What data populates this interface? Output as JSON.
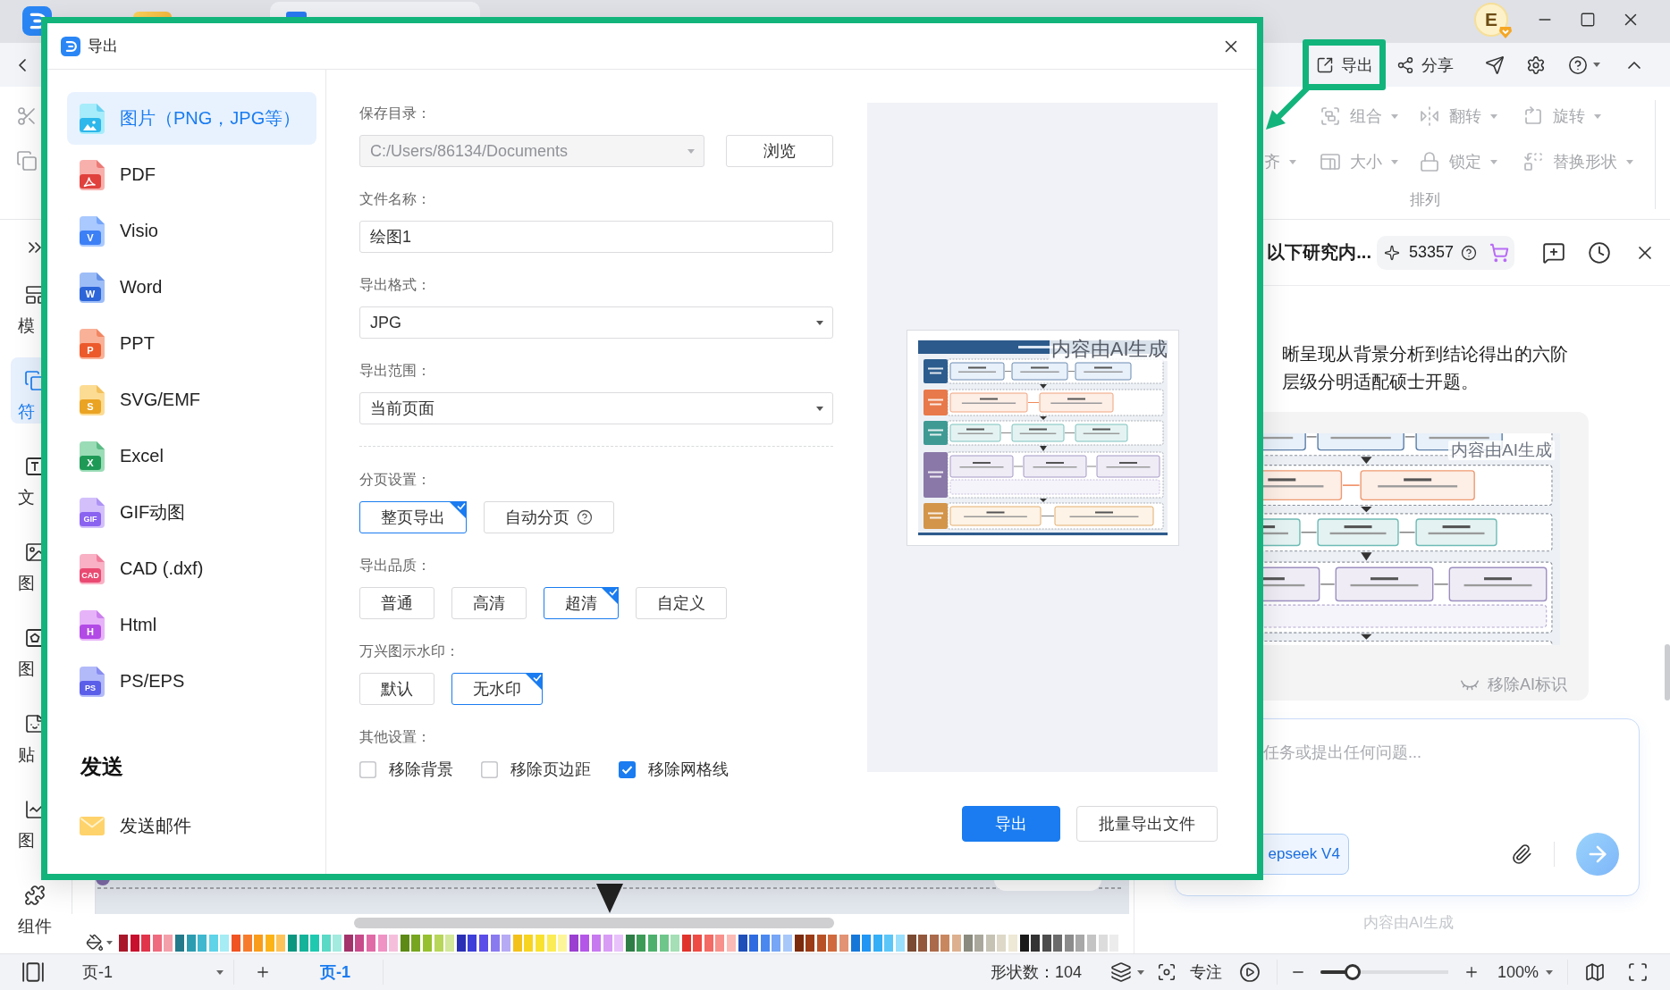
{
  "title_bar": {
    "avatar": "E"
  },
  "toolbar": {
    "actions": [
      {
        "kind": "export",
        "label": "导出",
        "highlighted": true
      },
      {
        "kind": "share",
        "label": "分享",
        "highlighted": false
      }
    ]
  },
  "ribbon": {
    "arrange": {
      "rows": [
        [
          "",
          {
            "kind": "group",
            "label": "组合",
            "disabled": true
          },
          {
            "kind": "flip",
            "label": "翻转",
            "disabled": true
          },
          {
            "kind": "rotate",
            "label": "旋转",
            "disabled": true
          }
        ],
        [
          {
            "kind": "text",
            "label": "齐",
            "disabled": true
          },
          {
            "kind": "size",
            "label": "大小",
            "disabled": true
          },
          {
            "kind": "lock",
            "label": "锁定",
            "disabled": true
          },
          {
            "kind": "replace",
            "label": "替换形状",
            "disabled": true
          }
        ]
      ],
      "label": "排列"
    }
  },
  "sidebar": {
    "items": [
      {
        "kind": "template",
        "label": "模",
        "selected": false
      },
      {
        "kind": "symbol",
        "label": "符",
        "selected": true
      },
      {
        "kind": "text",
        "label": "文",
        "selected": false
      },
      {
        "kind": "image",
        "label": "图",
        "selected": false
      },
      {
        "kind": "icon",
        "label": "图",
        "selected": false
      },
      {
        "kind": "sticker",
        "label": "贴",
        "selected": false
      },
      {
        "kind": "chart",
        "label": "图",
        "selected": false
      },
      {
        "kind": "component",
        "label": "组件",
        "selected": false
      }
    ]
  },
  "palette": [
    {
      "color": "#a8182a"
    },
    {
      "color": "#c8102e"
    },
    {
      "color": "#e0344b"
    },
    {
      "color": "#ef6a7e"
    },
    {
      "color": "#f3a0ab"
    },
    {
      "color": "#237a8a"
    },
    {
      "color": "#2c9cb0"
    },
    {
      "color": "#3fb8cf"
    },
    {
      "color": "#5fd3e8"
    },
    {
      "color": "#a5ecf5"
    },
    {
      "color": "#f05423"
    },
    {
      "color": "#f77b2d"
    },
    {
      "color": "#f99c1c"
    },
    {
      "color": "#fcb318"
    },
    {
      "color": "#fdc35a"
    },
    {
      "color": "#0b9680"
    },
    {
      "color": "#13b39a"
    },
    {
      "color": "#1fc9b0"
    },
    {
      "color": "#5ad9c6"
    },
    {
      "color": "#a3eadf"
    },
    {
      "color": "#a3336a"
    },
    {
      "color": "#c84a8a"
    },
    {
      "color": "#e06aa6"
    },
    {
      "color": "#ef92c4"
    },
    {
      "color": "#f5bfdc"
    },
    {
      "color": "#5c8a15"
    },
    {
      "color": "#77a520"
    },
    {
      "color": "#97c030"
    },
    {
      "color": "#b7d65a"
    },
    {
      "color": "#d3e89a"
    },
    {
      "color": "#2b2fb5"
    },
    {
      "color": "#3e3fd8"
    },
    {
      "color": "#5b4de8"
    },
    {
      "color": "#8a7af0"
    },
    {
      "color": "#b6aaf5"
    },
    {
      "color": "#f3c11b"
    },
    {
      "color": "#f7d421"
    },
    {
      "color": "#f9e12f"
    },
    {
      "color": "#fbec55"
    },
    {
      "color": "#fdf59a"
    },
    {
      "color": "#9a3fd0"
    },
    {
      "color": "#b457e8"
    },
    {
      "color": "#c779f0"
    },
    {
      "color": "#d89cf5"
    },
    {
      "color": "#e8c2fa"
    },
    {
      "color": "#2e7d46"
    },
    {
      "color": "#3d9b58"
    },
    {
      "color": "#4eb06d"
    },
    {
      "color": "#6fc68a"
    },
    {
      "color": "#a5dfb5"
    },
    {
      "color": "#e0332c"
    },
    {
      "color": "#ee4b45"
    },
    {
      "color": "#f46a64"
    },
    {
      "color": "#f8918b"
    },
    {
      "color": "#fbbab5"
    },
    {
      "color": "#1f4fb8"
    },
    {
      "color": "#2e6be0"
    },
    {
      "color": "#4a88f0"
    },
    {
      "color": "#76a6f5"
    },
    {
      "color": "#a8c8fa"
    },
    {
      "color": "#7b2a0c"
    },
    {
      "color": "#9a3b15"
    },
    {
      "color": "#b85226"
    },
    {
      "color": "#d06a3e"
    },
    {
      "color": "#e29275"
    },
    {
      "color": "#1677d8"
    },
    {
      "color": "#2196f3"
    },
    {
      "color": "#34aef5"
    },
    {
      "color": "#5cc6f8"
    },
    {
      "color": "#9adffc"
    },
    {
      "color": "#7a4a32"
    },
    {
      "color": "#93573b"
    },
    {
      "color": "#ab6a4b"
    },
    {
      "color": "#c98760"
    },
    {
      "color": "#ddb08f"
    },
    {
      "color": "#8a8a7e"
    },
    {
      "color": "#aaa89c"
    },
    {
      "color": "#c6c3b5"
    },
    {
      "color": "#ddd8c8"
    },
    {
      "color": "#eee8d6"
    },
    {
      "color": "#1a1a1a"
    },
    {
      "color": "#333333"
    },
    {
      "color": "#4d4d4d"
    },
    {
      "color": "#6b6b6b"
    },
    {
      "color": "#8c8c8c"
    },
    {
      "color": "#a8a8a8"
    },
    {
      "color": "#c4c4c4"
    },
    {
      "color": "#dcdcdc"
    },
    {
      "color": "#ececec"
    }
  ],
  "ai_panel": {
    "title": "以下研究内...",
    "credits": "53357",
    "message": "晰呈现从背景分析到结论得出的六阶层级分明适配硕士开题。",
    "image_label": "内容由AI生成",
    "remove_ai_mark": "移除AI标识",
    "input": {
      "placeholder": "任务或提出任何问题..."
    },
    "model": "epseek V4",
    "footer": "内容由AI生成"
  },
  "status_bar": {
    "page_select": "页-1",
    "pages": [
      {
        "label": "页-1",
        "selected": true
      }
    ],
    "shape_count": "形状数：104",
    "focus": "专注",
    "zoom": {
      "level": 0.25,
      "value": "100%"
    }
  },
  "export_dialog": {
    "title": "导出",
    "highlighted": true,
    "formats": [
      {
        "kind": "image",
        "label": "图片（PNG，JPG等）",
        "selected": true
      },
      {
        "kind": "pdf",
        "label": "PDF",
        "selected": false
      },
      {
        "kind": "visio",
        "label": "Visio",
        "badge": "V",
        "selected": false
      },
      {
        "kind": "word",
        "label": "Word",
        "badge": "W",
        "selected": false
      },
      {
        "kind": "ppt",
        "label": "PPT",
        "badge": "P",
        "selected": false
      },
      {
        "kind": "svg",
        "label": "SVG/EMF",
        "badge": "S",
        "selected": false
      },
      {
        "kind": "excel",
        "label": "Excel",
        "badge": "X",
        "selected": false
      },
      {
        "kind": "gif",
        "label": "GIF动图",
        "badge": "GIF",
        "selected": false
      },
      {
        "kind": "cad",
        "label": "CAD (.dxf)",
        "badge": "CAD",
        "selected": false
      },
      {
        "kind": "html",
        "label": "Html",
        "badge": "H",
        "selected": false
      },
      {
        "kind": "ps",
        "label": "PS/EPS",
        "badge": "PS",
        "selected": false
      }
    ],
    "send": {
      "heading": "发送",
      "items": [
        {
          "kind": "mail",
          "label": "发送邮件"
        }
      ]
    },
    "fields": [
      {
        "kind": "select",
        "label": "保存目录：",
        "value": "C:/Users/86134/Documents",
        "disabled": true,
        "button": "浏览"
      },
      {
        "kind": "input",
        "label": "文件名称：",
        "value": "绘图1",
        "disabled": false
      },
      {
        "kind": "select",
        "label": "导出格式：",
        "value": "JPG",
        "disabled": false
      },
      {
        "kind": "select",
        "label": "导出范围：",
        "value": "当前页面",
        "disabled": false
      }
    ],
    "option_groups": [
      {
        "label": "分页设置：",
        "options": [
          {
            "label": "整页导出",
            "selected": true
          },
          {
            "label": "自动分页",
            "selected": false,
            "help": true
          }
        ]
      },
      {
        "label": "导出品质：",
        "options": [
          {
            "label": "普通",
            "selected": false
          },
          {
            "label": "高清",
            "selected": false
          },
          {
            "label": "超清",
            "selected": true
          },
          {
            "label": "自定义",
            "selected": false
          }
        ]
      },
      {
        "label": "万兴图示水印：",
        "options": [
          {
            "label": "默认",
            "selected": false
          },
          {
            "label": "无水印",
            "selected": true
          }
        ]
      }
    ],
    "other_settings": {
      "label": "其他设置：",
      "checks": [
        {
          "label": "移除背景",
          "checked": false
        },
        {
          "label": "移除页边距",
          "checked": false
        },
        {
          "label": "移除网格线",
          "checked": true
        }
      ]
    },
    "preview": {
      "ai_label": "内容由AI生成"
    },
    "buttons": [
      {
        "kind": "primary",
        "label": "导出"
      },
      {
        "kind": "default",
        "label": "批量导出文件"
      }
    ]
  }
}
